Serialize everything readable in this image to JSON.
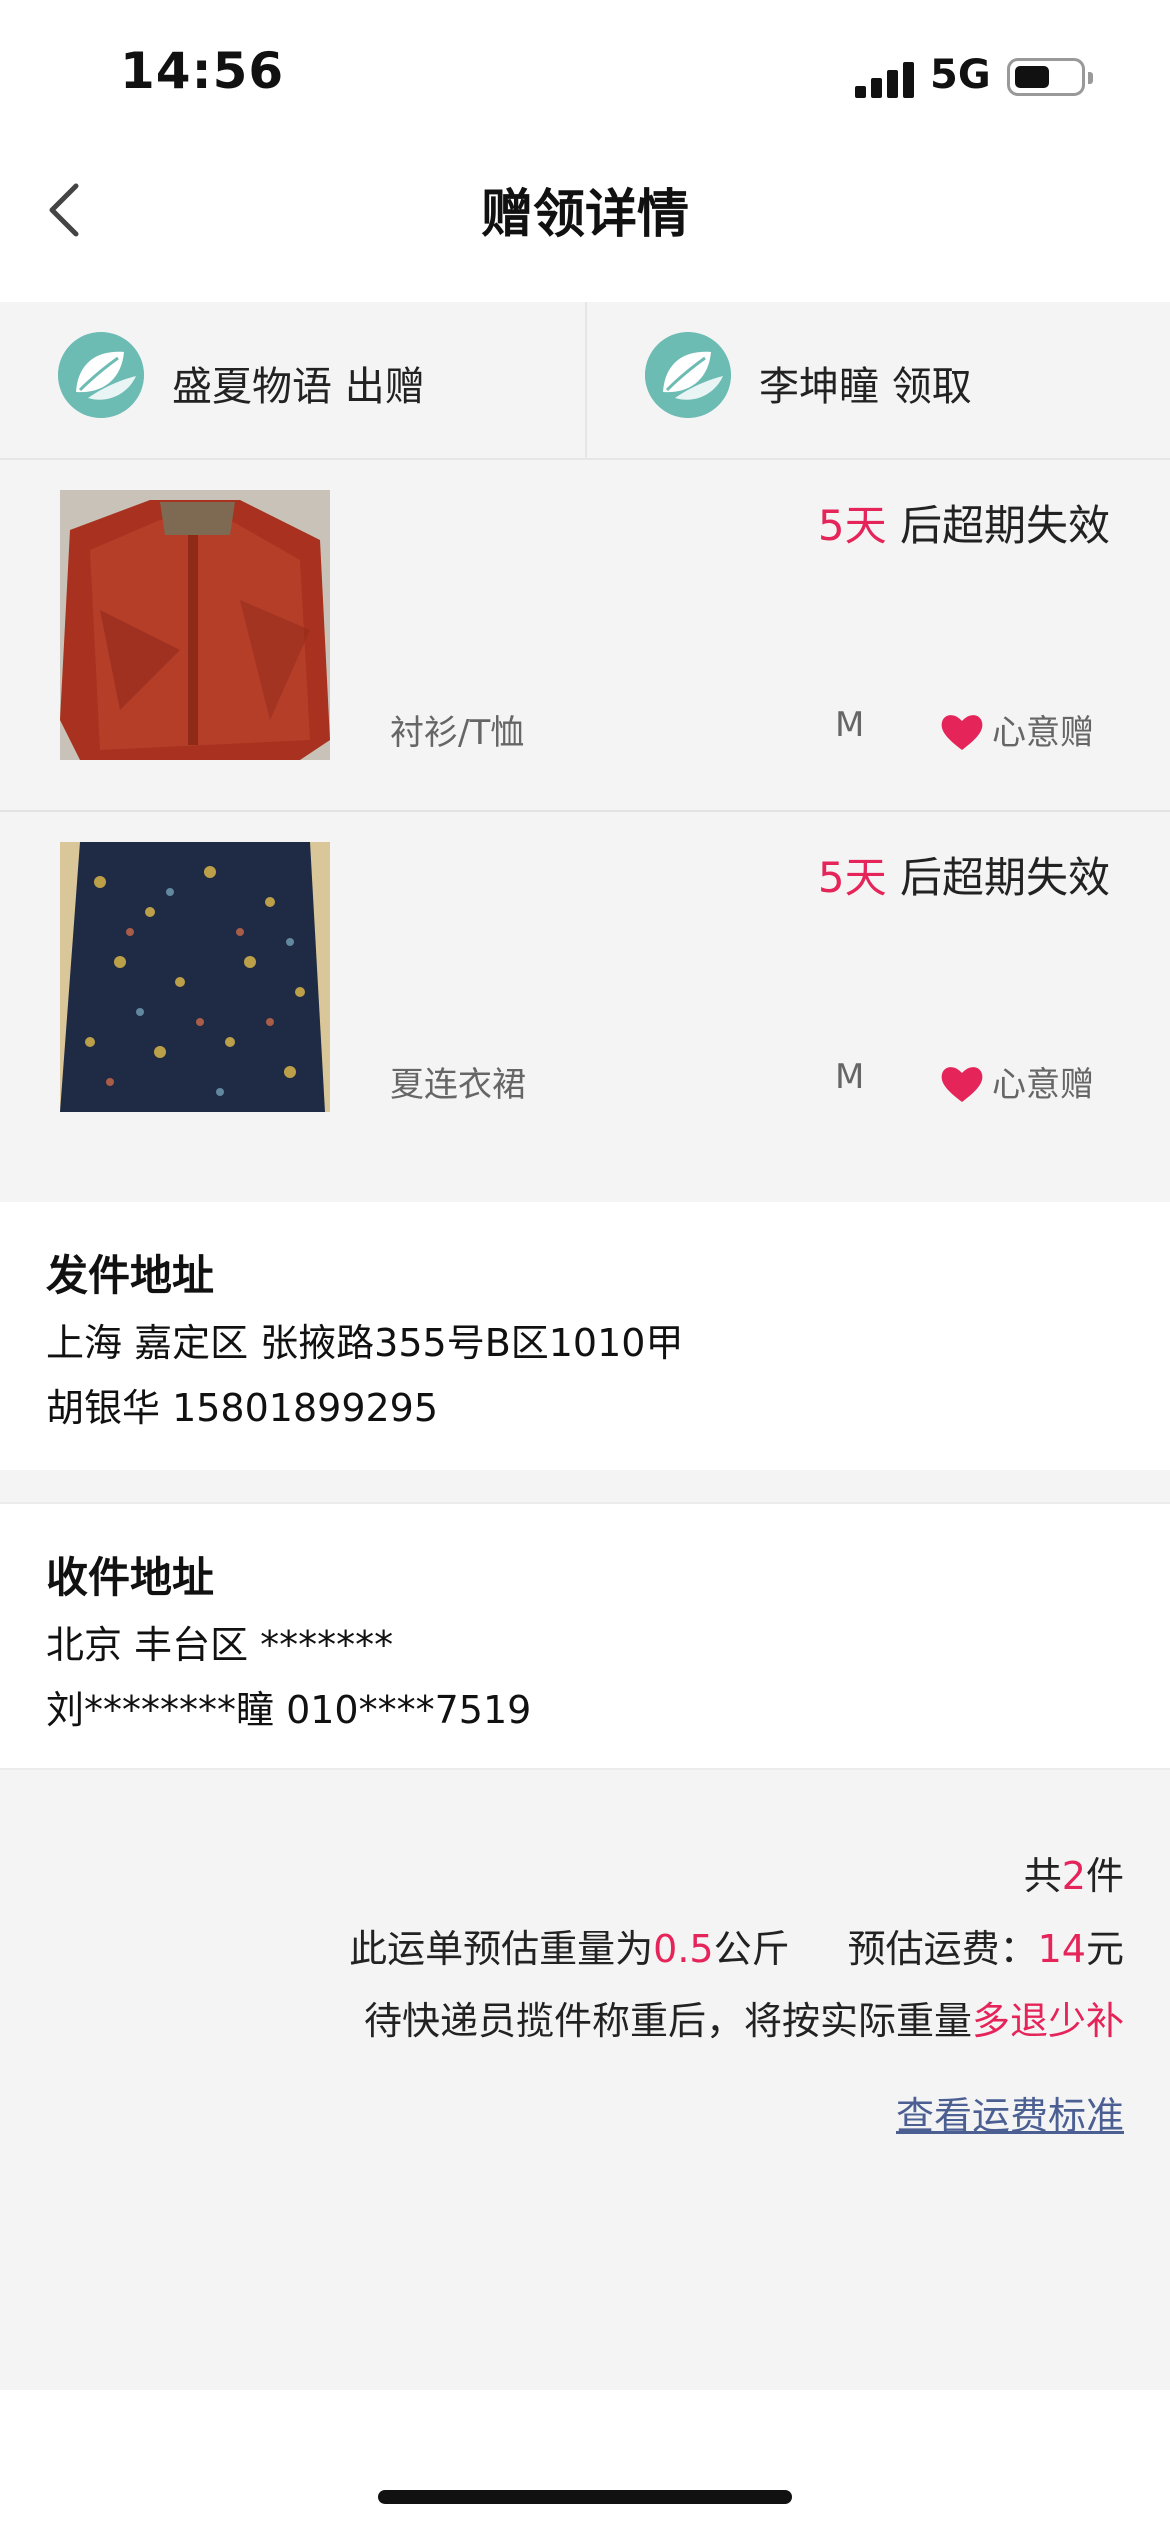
{
  "status_bar": {
    "time": "14:56",
    "network": "5G"
  },
  "nav": {
    "title": "赠领详情"
  },
  "users": [
    {
      "name": "盛夏物语 出赠"
    },
    {
      "name": "李坤瞳 领取"
    }
  ],
  "items": [
    {
      "expiry_days": "5天",
      "expiry_suffix": " 后超期失效",
      "category": "衬衫/T恤",
      "size": "M",
      "gift_label": "心意赠"
    },
    {
      "expiry_days": "5天",
      "expiry_suffix": " 后超期失效",
      "category": "夏连衣裙",
      "size": "M",
      "gift_label": "心意赠"
    }
  ],
  "sender": {
    "label": "发件地址",
    "address": "上海 嘉定区 张掖路355号B区1010甲",
    "contact": "胡银华 15801899295"
  },
  "receiver": {
    "label": "收件地址",
    "address": "北京 丰台区 *******",
    "contact": "刘********瞳 010****7519"
  },
  "summary": {
    "count_prefix": "共",
    "count": "2",
    "count_suffix": "件",
    "weight_prefix": "此运单预估重量为",
    "weight": "0.5",
    "weight_unit": "公斤",
    "fee_prefix": "预估运费：",
    "fee": "14",
    "fee_unit": "元",
    "note_prefix": "待快递员揽件称重后，将按实际重量",
    "note_highlight": "多退少补",
    "link": "查看运费标准"
  },
  "colors": {
    "accent": "#e5245a",
    "link": "#4b5f93",
    "avatar": "#6dbcb4"
  }
}
